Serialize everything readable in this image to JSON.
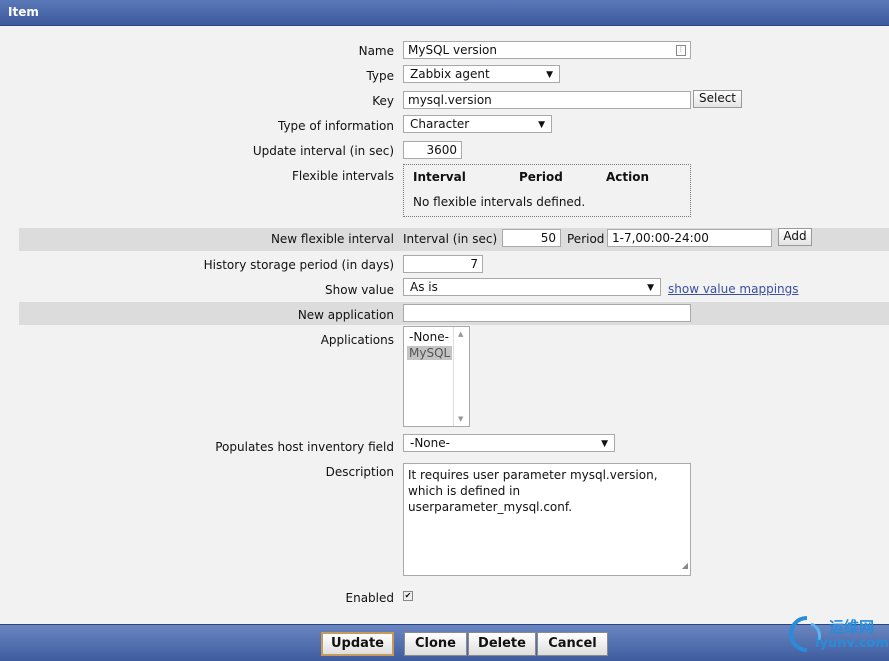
{
  "window": {
    "title": "Item"
  },
  "form": {
    "name": {
      "label": "Name",
      "value": "MySQL version"
    },
    "type": {
      "label": "Type",
      "value": "Zabbix agent"
    },
    "key": {
      "label": "Key",
      "value": "mysql.version",
      "select_button": "Select"
    },
    "type_of_information": {
      "label": "Type of information",
      "value": "Character"
    },
    "update_interval": {
      "label": "Update interval (in sec)",
      "value": "3600"
    },
    "flexible_intervals": {
      "label": "Flexible intervals",
      "columns": [
        "Interval",
        "Period",
        "Action"
      ],
      "empty_text": "No flexible intervals defined."
    },
    "new_flexible_interval": {
      "label": "New flexible interval",
      "interval_label": "Interval (in sec)",
      "interval_value": "50",
      "period_label": "Period",
      "period_value": "1-7,00:00-24:00",
      "add_button": "Add"
    },
    "history": {
      "label": "History storage period (in days)",
      "value": "7"
    },
    "show_value": {
      "label": "Show value",
      "value": "As is",
      "link": "show value mappings"
    },
    "new_application": {
      "label": "New application",
      "value": ""
    },
    "applications": {
      "label": "Applications",
      "options": [
        "-None-",
        "MySQL"
      ],
      "selected_index": 1
    },
    "inventory": {
      "label": "Populates host inventory field",
      "value": "-None-"
    },
    "description": {
      "label": "Description",
      "lines": [
        "It requires user parameter mysql.version,",
        "which is defined in userparameter_mysql.conf."
      ]
    },
    "enabled": {
      "label": "Enabled",
      "checked": true
    }
  },
  "footer": {
    "buttons": [
      "Update",
      "Clone",
      "Delete",
      "Cancel"
    ]
  },
  "watermark": {
    "line1": "运维网",
    "line2": "iyunv.com"
  }
}
